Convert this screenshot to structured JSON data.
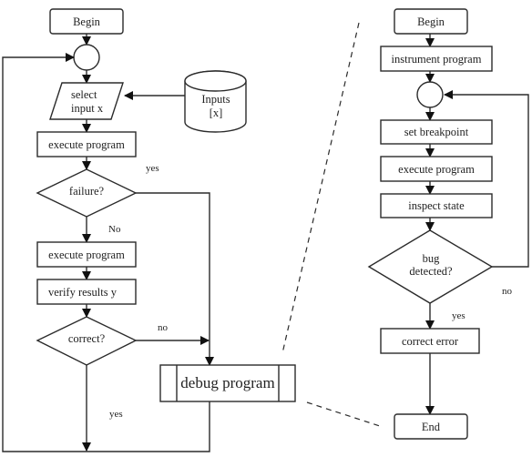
{
  "diagram": {
    "left_flow": {
      "begin": "Begin",
      "select_input": [
        "select",
        "input x"
      ],
      "inputs_store": [
        "Inputs",
        "[x]"
      ],
      "execute_program_1": "execute program",
      "failure_decision": "failure?",
      "failure_yes": "yes",
      "failure_no": "No",
      "execute_program_2": "execute program",
      "verify_results": "verify results y",
      "correct_decision": "correct?",
      "correct_no": "no",
      "correct_yes": "yes",
      "debug_program": "debug program"
    },
    "right_flow": {
      "begin": "Begin",
      "instrument_program": "instrument program",
      "set_breakpoint": "set breakpoint",
      "execute_program": "execute program",
      "inspect_state": "inspect state",
      "bug_decision": [
        "bug",
        "detected?"
      ],
      "bug_no": "no",
      "bug_yes": "yes",
      "correct_error": "correct error",
      "end": "End"
    }
  }
}
